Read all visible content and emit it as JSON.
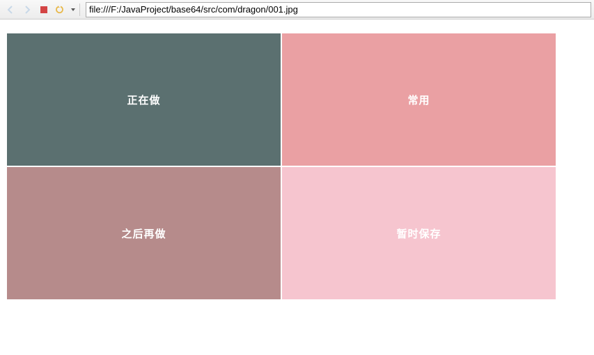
{
  "toolbar": {
    "url": "file:///F:/JavaProject/base64/src/com/dragon/001.jpg"
  },
  "quadrants": {
    "top_left": {
      "label": "正在做"
    },
    "top_right": {
      "label": "常用"
    },
    "bottom_left": {
      "label": "之后再做"
    },
    "bottom_right": {
      "label": "暂时保存"
    }
  },
  "colors": {
    "top_left": "#5b7070",
    "top_right": "#eaa0a3",
    "bottom_left": "#b68b8b",
    "bottom_right": "#f6c5cf"
  }
}
